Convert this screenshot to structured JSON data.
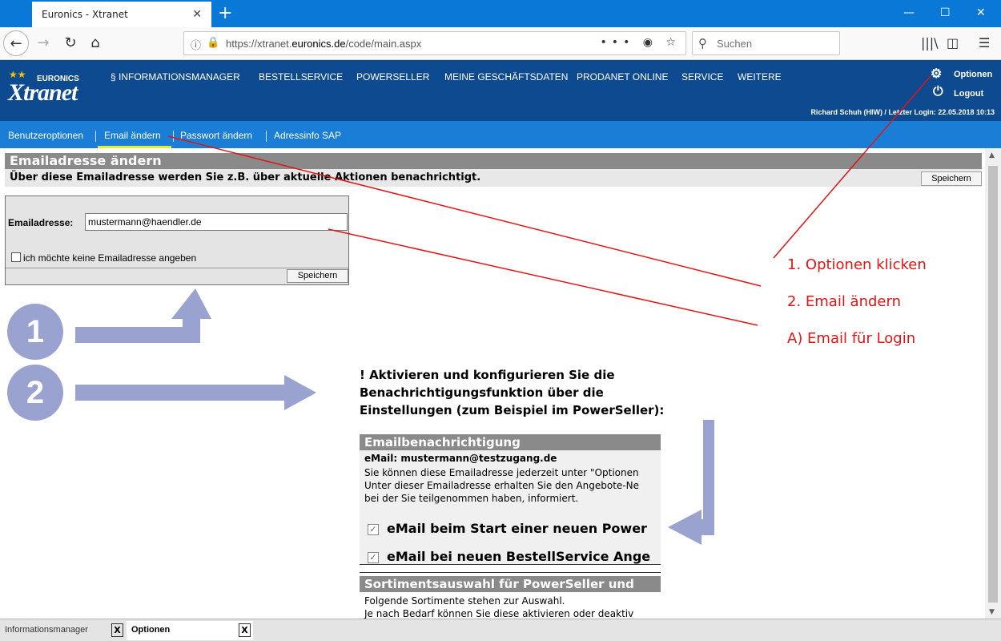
{
  "browser": {
    "tab_title": "Euronics - Xtranet",
    "tab_close": "✕",
    "new_tab": "+",
    "url_prefix": "https://xtranet.",
    "url_domain": "euronics.de",
    "url_path": "/code/main.aspx",
    "search_placeholder": "Suchen"
  },
  "site": {
    "logo_brand": "EURONICS",
    "logo_name": "Xtranet",
    "nav": [
      {
        "label": "§  INFORMATIONSMANAGER"
      },
      {
        "label": "BESTELLSERVICE"
      },
      {
        "label": "POWERSELLER"
      },
      {
        "label": "MEINE GESCHÄFTSDATEN"
      },
      {
        "label": "PRODANET ONLINE"
      },
      {
        "label": "SERVICE"
      },
      {
        "label": "WEITERE"
      }
    ],
    "options_label": "Optionen",
    "logout_label": "Logout",
    "user_line": "Richard Schuh (HIW) / Letzter Login: 22.05.2018 10:13"
  },
  "subnav": [
    {
      "label": "Benutzeroptionen"
    },
    {
      "label": "Email ändern",
      "active": true
    },
    {
      "label": "Passwort ändern"
    },
    {
      "label": "Adressinfo SAP"
    }
  ],
  "section": {
    "title": "Emailadresse ändern",
    "subtitle": "Über diese Emailadresse werden Sie z.B. über aktuelle Aktionen benachrichtigt.",
    "save_label": "Speichern"
  },
  "form": {
    "email_label": "Emailadresse:",
    "email_value": "mustermann@haendler.de",
    "no_email_label": "ich möchte keine Emailadresse angeben",
    "save_label": "Speichern"
  },
  "annotations": {
    "circle1": "1",
    "circle2": "2",
    "step1": "1. Optionen klicken",
    "step2": "2. Email ändern",
    "stepA": "A) Email für Login",
    "instruction": "! Aktivieren und konfigurieren Sie die Benachrichtigungsfunktion über die Einstellungen (zum Beispiel im PowerSeller):",
    "annotation_color": "#e01515",
    "arrow_color": "#9aa3d0"
  },
  "notification": {
    "title": "Emailbenachrichtigung",
    "email_line": "eMail: mustermann@testzugang.de",
    "text1": "Sie können diese Emailadresse jederzeit unter \"Optionen",
    "text2": "Unter dieser Emailadresse erhalten Sie den Angebote-Ne",
    "text3": "bei der Sie teilgenommen haben, informiert.",
    "option1": "eMail beim Start einer neuen Power",
    "option2": "eMail bei neuen BestellService Ange",
    "section2_title": "Sortimentsauswahl für PowerSeller und",
    "section2_text1": "Folgende Sortimente stehen zur Auswahl.",
    "section2_text2": "Je nach Bedarf können Sie diese aktivieren oder deaktiv"
  },
  "bottom_tabs": [
    {
      "label": "Informationsmanager"
    },
    {
      "label": "Optionen",
      "active": true
    }
  ],
  "colors": {
    "header_blue": "#0d4a8f",
    "subnav_blue": "#1a7ed6",
    "titlebar_blue": "#0a78d7",
    "active_underline": "#e2ec3a"
  }
}
